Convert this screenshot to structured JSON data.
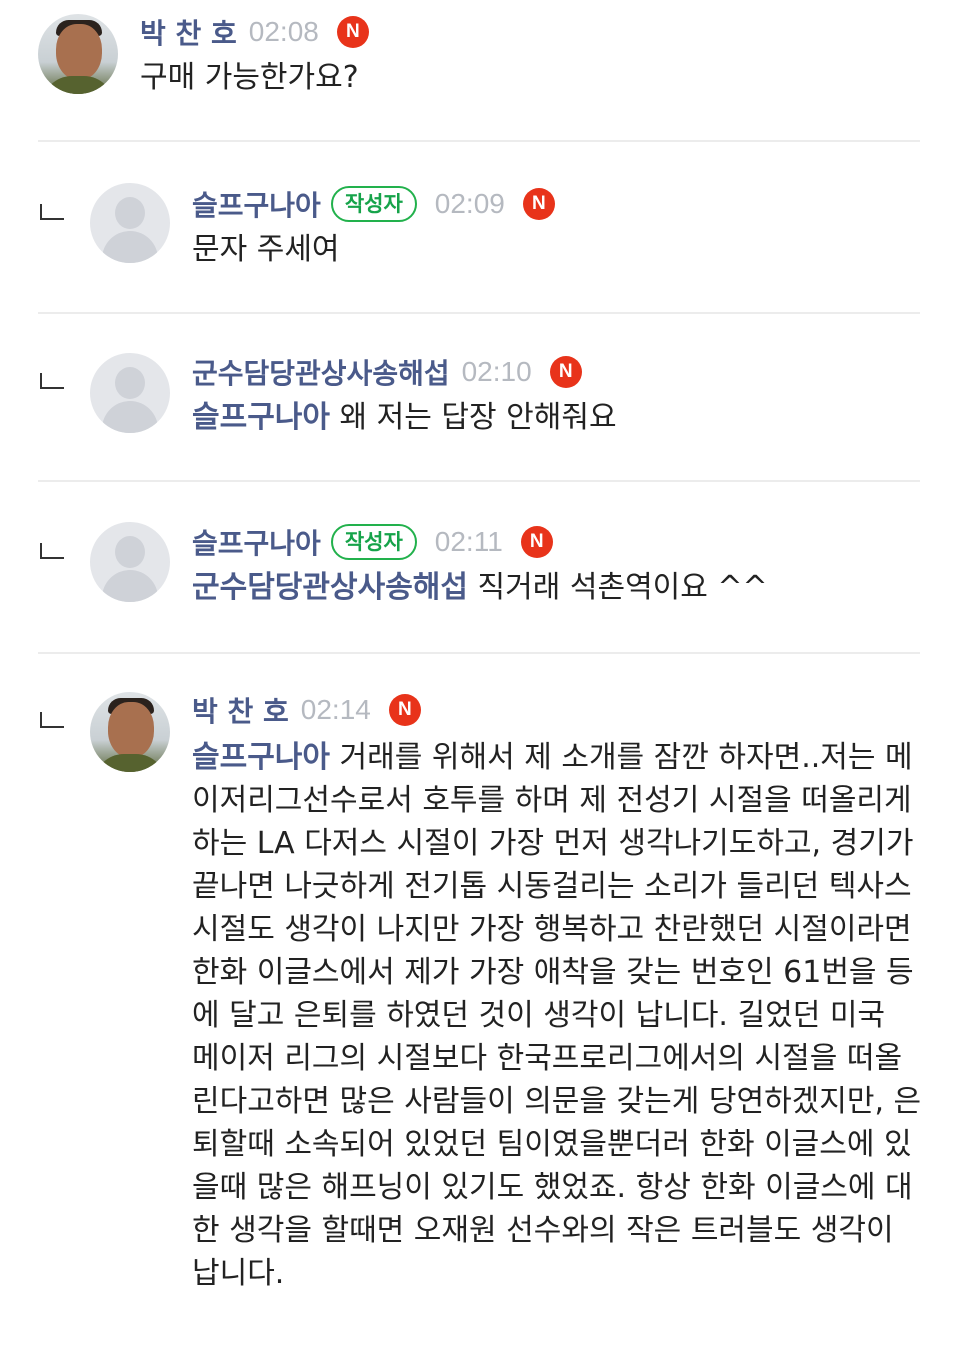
{
  "comments": [
    {
      "nickname": "박 찬 호",
      "time": "02:08",
      "new_badge": "N",
      "text": "구매 가능한가요?",
      "avatar": "player-photo"
    },
    {
      "nickname": "슬프구나아",
      "author_badge": "작성자",
      "time": "02:09",
      "new_badge": "N",
      "text": "문자 주세여",
      "avatar": "default-avatar"
    },
    {
      "nickname": "군수담당관상사송해섭",
      "time": "02:10",
      "new_badge": "N",
      "mention": "슬프구나아",
      "text": " 왜 저는 답장 안해줘요",
      "avatar": "default-avatar"
    },
    {
      "nickname": "슬프구나아",
      "author_badge": "작성자",
      "time": "02:11",
      "new_badge": "N",
      "mention": "군수담당관상사송해섭",
      "text": " 직거래 석촌역이요 ^^",
      "avatar": "default-avatar"
    },
    {
      "nickname": "박 찬 호",
      "time": "02:14",
      "new_badge": "N",
      "mention": "슬프구나아",
      "text": " 거래를 위해서 제 소개를 잠깐 하자면..저는 메이저리그선수로서 호투를 하며 제 전성기 시절을 떠올리게하는 LA 다저스 시절이 가장 먼저 생각나기도하고, 경기가 끝나면 나긋하게 전기톱 시동걸리는 소리가 들리던 텍사스 시절도 생각이 나지만 가장 행복하고 찬란했던 시절이라면 한화 이글스에서 제가 가장 애착을 갖는 번호인 61번을 등에 달고 은퇴를 하였던 것이 생각이 납니다. 길었던 미국 메이저 리그의 시절보다 한국프로리그에서의 시절을 떠올린다고하면 많은 사람들이 의문을 갖는게 당연하겠지만, 은퇴할때 소속되어 있었던 팀이였을뿐더러 한화 이글스에 있을때 많은 해프닝이 있기도 했었죠. 항상 한화 이글스에 대한 생각을 할때면 오재원 선수와의 작은 트러블도 생각이 납니다.",
      "avatar": "player-photo"
    }
  ],
  "colors": {
    "nickname": "#4a5a8a",
    "time": "#b5b9c0",
    "new_badge": "#e8331a",
    "author_badge": "#22b14c",
    "divider": "#ececec"
  }
}
